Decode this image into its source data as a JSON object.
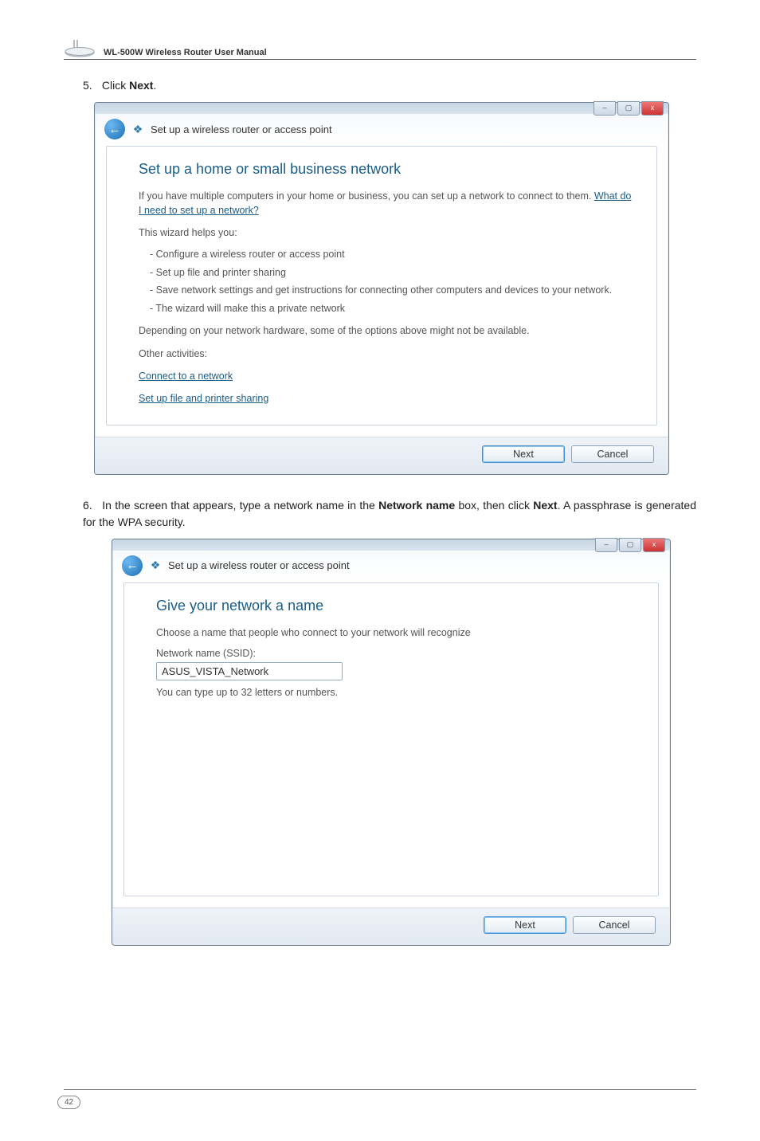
{
  "header": {
    "manual_title": "WL-500W Wireless Router User Manual"
  },
  "steps": {
    "s5_num": "5.",
    "s5_pre": "Click ",
    "s5_bold": "Next",
    "s5_post": ".",
    "s6_num": "6.",
    "s6_pre": "In the screen that appears, type a network name in the ",
    "s6_bold1": "Network name",
    "s6_mid": " box, then click ",
    "s6_bold2": "Next",
    "s6_post": ". A passphrase is generated for the WPA security."
  },
  "common": {
    "nav_title": "Set up a wireless router or access point",
    "btn_next": "Next",
    "btn_cancel": "Cancel",
    "win_min": "–",
    "win_max": "▢",
    "win_close": "x",
    "back_arrow": "←",
    "wiz_icon": "❖"
  },
  "dialog1": {
    "heading": "Set up a home or small business network",
    "intro_pre": "If you have multiple computers in your home or business, you can set up a network to connect to them.  ",
    "intro_link": "What do I need to set up a network?",
    "helps": "This wizard helps you:",
    "b1": "- Configure a wireless router or access point",
    "b2": "- Set up file and printer sharing",
    "b3": "- Save network settings and get instructions for connecting other computers and devices to your network.",
    "b4": "- The wizard will make this a private network",
    "depending": "Depending on your network hardware, some of the options above might not be available.",
    "other": "Other activities:",
    "link1": "Connect to a network",
    "link2": "Set up file and printer sharing"
  },
  "dialog2": {
    "heading": "Give your network a name",
    "choose": "Choose a name that people who connect to your network will recognize",
    "label": "Network name (SSID):",
    "value": "ASUS_VISTA_Network",
    "hint": "You can type up to 32 letters or numbers."
  },
  "footer": {
    "page_number": "42"
  }
}
